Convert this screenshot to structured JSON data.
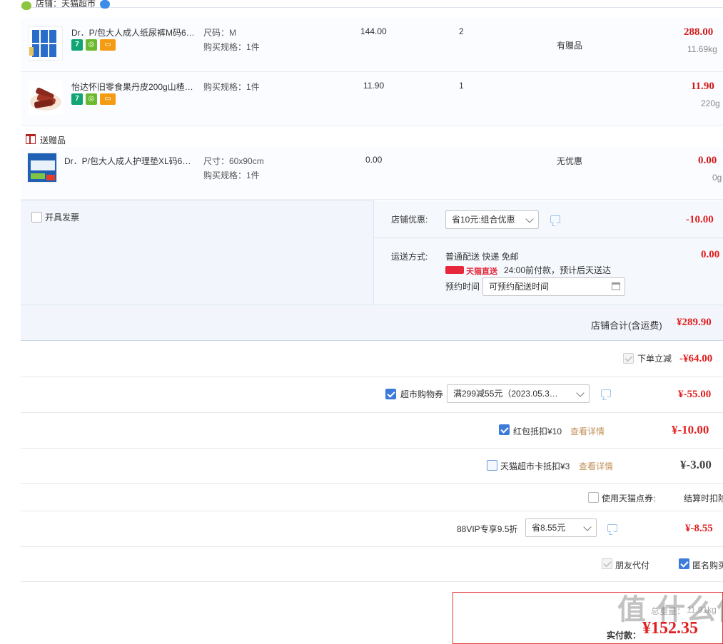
{
  "store": {
    "label": "店铺：天猫超市"
  },
  "items": [
    {
      "name": "Dr．P/包大人成人纸尿裤M码6…",
      "spec1": "尺码：M",
      "spec2": "购买规格：1件",
      "unit_price": "144.00",
      "qty": "2",
      "promo": "有赠品",
      "total": "288.00",
      "weight": "11.69kg"
    },
    {
      "name": "怡达怀旧零食果丹皮200g山楂…",
      "spec1": "购买规格：1件",
      "unit_price": "11.90",
      "qty": "1",
      "total": "11.90",
      "weight": "220g"
    }
  ],
  "gift_section": {
    "title": "送赠品",
    "item": {
      "name": "Dr．P/包大人成人护理垫XL码6…",
      "spec1": "尺寸：60x90cm",
      "spec2": "购买规格：1件",
      "unit_price": "0.00",
      "promo": "无优惠",
      "total": "0.00",
      "weight": "0g"
    }
  },
  "invoice": {
    "label": "开具发票"
  },
  "shop_discount": {
    "label": "店铺优惠:",
    "selected": "省10元:组合优惠",
    "amount": "-10.00"
  },
  "shipping": {
    "label": "运送方式:",
    "method": "普通配送 快递 免邮",
    "tmall_tag": "天猫直送",
    "eta": "24:00前付款，预计后天送达",
    "reserve_label": "预约时间",
    "reserve_placeholder": "可预约配送时间",
    "amount": "0.00"
  },
  "shop_total": {
    "label": "店铺合计(含运费)",
    "amount": "¥289.90"
  },
  "discounts": {
    "instant": {
      "label": "下单立减",
      "amount": "-¥64.00"
    },
    "coupon": {
      "label": "超市购物券",
      "selected": "满299减55元（2023.05.3…",
      "amount": "¥-55.00"
    },
    "redpacket": {
      "label": "红包抵扣¥10",
      "link": "查看详情",
      "amount": "¥-10.00"
    },
    "card": {
      "label": "天猫超市卡抵扣¥3",
      "link": "查看详情",
      "amount": "¥-3.00"
    },
    "points": {
      "label": "使用天猫点券:",
      "note": "结算时扣除"
    },
    "vip": {
      "label": "88VIP专享9.5折",
      "selected": "省8.55元",
      "amount": "¥-8.55"
    }
  },
  "options": {
    "friend_pay": "朋友代付",
    "anonymous": "匿名购买"
  },
  "payment": {
    "weight_label": "总重量：",
    "weight_value": "11.91kg",
    "actual_label": "实付款：",
    "actual_amount": "¥152.35",
    "watermark": "值 什么值得买"
  },
  "colors": {
    "accent_red": "#e02020",
    "checkbox_blue": "#3c7bd9",
    "link_gold": "#c2905a"
  }
}
